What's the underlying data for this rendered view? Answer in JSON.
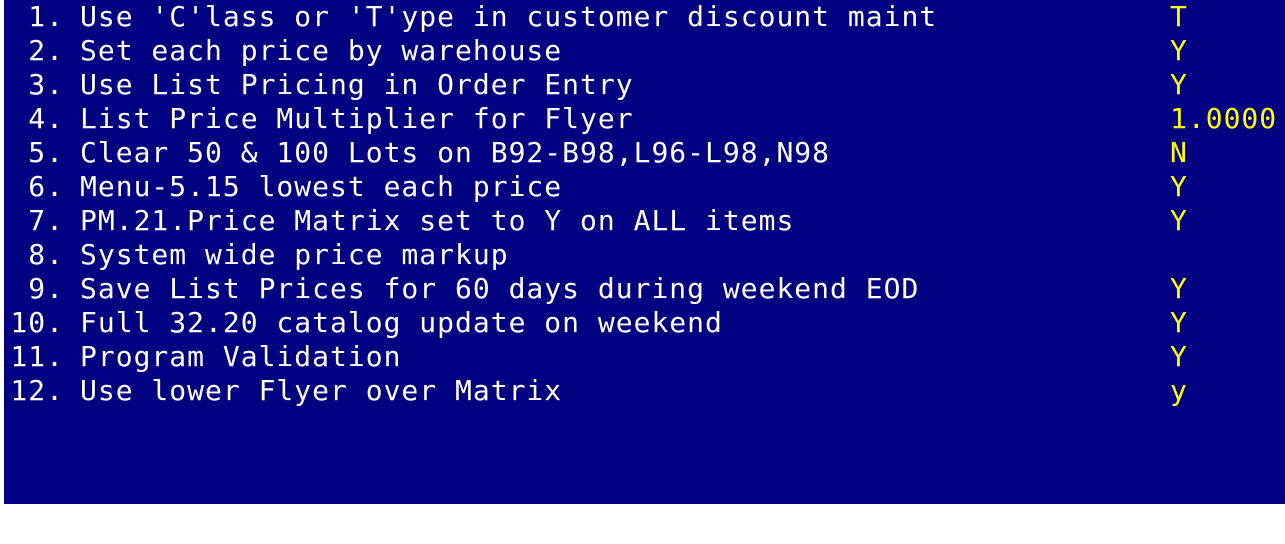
{
  "colors": {
    "background": "#000080",
    "text": "#ffffff",
    "value": "#ffff00"
  },
  "options": [
    {
      "num": "1.",
      "label": "Use 'C'lass or 'T'ype in customer discount maint",
      "value": "T"
    },
    {
      "num": "2.",
      "label": "Set each price by warehouse",
      "value": "Y"
    },
    {
      "num": "3.",
      "label": "Use List Pricing in Order Entry",
      "value": "Y"
    },
    {
      "num": "4.",
      "label": "List Price Multiplier for Flyer",
      "value": "1.0000"
    },
    {
      "num": "5.",
      "label": "Clear 50 & 100 Lots on B92-B98,L96-L98,N98",
      "value": "N"
    },
    {
      "num": "6.",
      "label": "Menu-5.15 lowest each price",
      "value": "Y"
    },
    {
      "num": "7.",
      "label": "PM.21.Price Matrix set to Y on ALL items",
      "value": "Y"
    },
    {
      "num": "8.",
      "label": "System wide price markup",
      "value": ""
    },
    {
      "num": "9.",
      "label": "Save List Prices for 60 days during weekend EOD",
      "value": "Y"
    },
    {
      "num": "10.",
      "label": "Full 32.20 catalog update on weekend",
      "value": "Y"
    },
    {
      "num": "11.",
      "label": "Program Validation",
      "value": "Y"
    },
    {
      "num": "12.",
      "label": "Use lower Flyer over Matrix",
      "value": "y"
    }
  ]
}
